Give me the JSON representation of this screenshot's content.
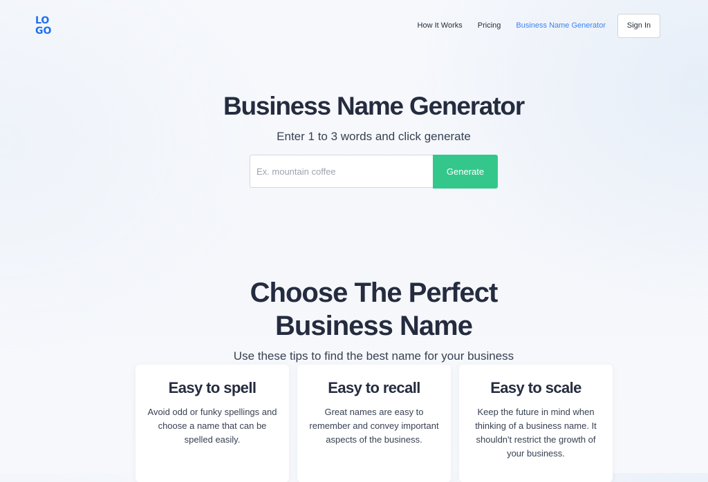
{
  "header": {
    "logo_top": "LO",
    "logo_bottom": "GO",
    "nav": [
      {
        "label": "How It Works"
      },
      {
        "label": "Pricing"
      },
      {
        "label": "Business Name Generator"
      }
    ],
    "signin_label": "Sign In",
    "accent_color": "#3b82f6"
  },
  "hero": {
    "title": "Business Name Generator",
    "subtitle": "Enter 1 to 3 words and click generate",
    "input_placeholder": "Ex. mountain coffee",
    "input_value": "",
    "generate_label": "Generate",
    "generate_color": "#34c78c"
  },
  "tips": {
    "title_line1": "Choose The Perfect",
    "title_line2": "Business Name",
    "subtitle": "Use these tips to find the best name for your business",
    "cards": [
      {
        "title": "Easy to spell",
        "body": "Avoid odd or funky spellings and choose a name that can be spelled easily."
      },
      {
        "title": "Easy to recall",
        "body": "Great names are easy to remember and convey important aspects of the business."
      },
      {
        "title": "Easy to scale",
        "body": "Keep the future in mind when thinking of a business name. It shouldn't restrict the growth of your business."
      }
    ]
  }
}
